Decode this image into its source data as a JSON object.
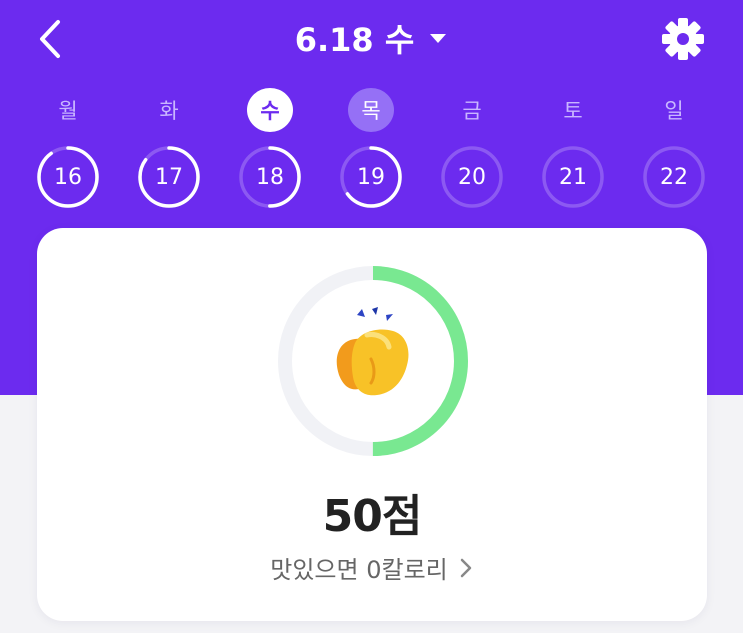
{
  "header": {
    "title": "6.18 수",
    "back_icon": "chevron-left-icon",
    "dropdown_icon": "caret-down-icon",
    "settings_icon": "gear-icon"
  },
  "weekdays": [
    "월",
    "화",
    "수",
    "목",
    "금",
    "토",
    "일"
  ],
  "days": [
    {
      "num": "16",
      "progress": 0.9
    },
    {
      "num": "17",
      "progress": 0.85
    },
    {
      "num": "18",
      "progress": 0.5
    },
    {
      "num": "19",
      "progress": 0.65
    },
    {
      "num": "20",
      "progress": 0
    },
    {
      "num": "21",
      "progress": 0
    },
    {
      "num": "22",
      "progress": 0
    }
  ],
  "today_index": 2,
  "selected_index": 3,
  "card": {
    "icon": "clapping-hands-icon",
    "score_progress": 0.5,
    "score": "50점",
    "subtitle": "맛있으면 0칼로리"
  },
  "colors": {
    "primary": "#6c2bef",
    "ring_green": "#79e891",
    "ring_track": "#f1f2f6"
  }
}
